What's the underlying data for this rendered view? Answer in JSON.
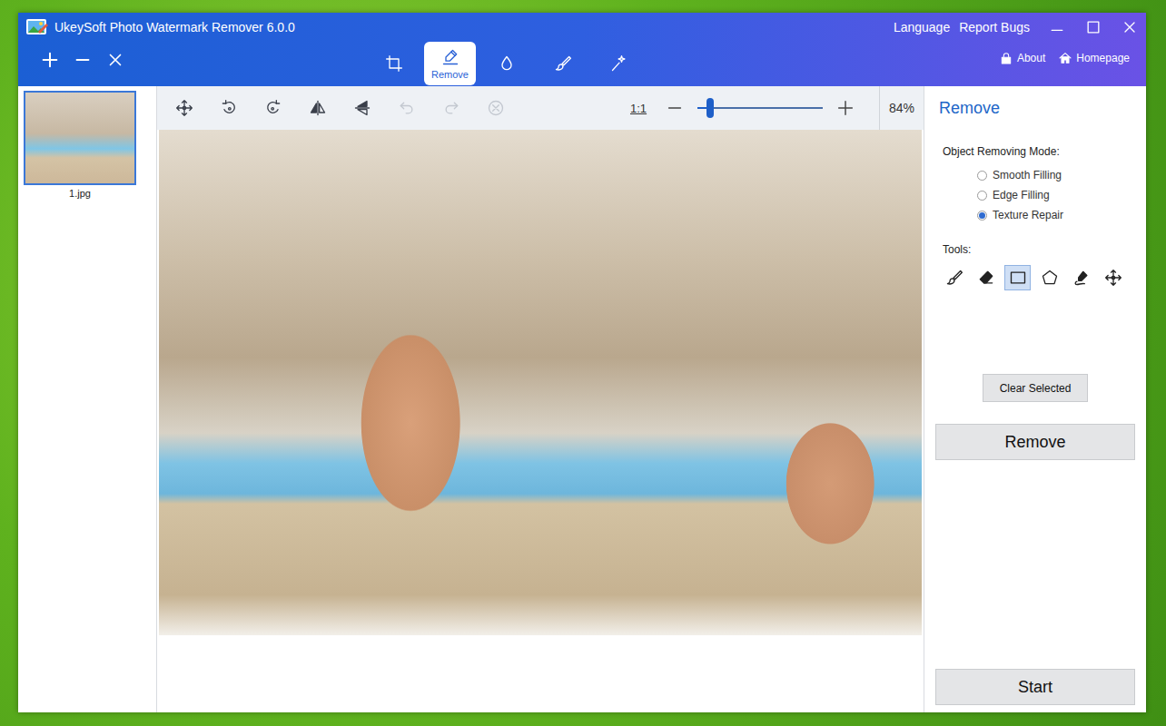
{
  "window": {
    "title": "UkeySoft Photo Watermark Remover 6.0.0"
  },
  "header_links": [
    {
      "label": "Language"
    },
    {
      "label": "Report Bugs"
    }
  ],
  "tabs": [
    {
      "kind": "crop",
      "selected": false
    },
    {
      "kind": "remove",
      "label": "Remove",
      "selected": true
    },
    {
      "kind": "watermark",
      "selected": false
    },
    {
      "kind": "brush",
      "selected": false
    },
    {
      "kind": "magic",
      "selected": false
    }
  ],
  "nav_links": [
    {
      "kind": "about",
      "label": "About"
    },
    {
      "kind": "home",
      "label": "Homepage"
    }
  ],
  "files": [
    {
      "label": "1.jpg",
      "selected": true
    }
  ],
  "canvas_tools": [
    {
      "kind": "move",
      "disabled": false
    },
    {
      "kind": "rotate-left",
      "disabled": false
    },
    {
      "kind": "rotate-right",
      "disabled": false
    },
    {
      "kind": "flip-horizontal",
      "disabled": false
    },
    {
      "kind": "flip-vertical",
      "disabled": false
    },
    {
      "kind": "undo",
      "disabled": true
    },
    {
      "kind": "redo",
      "disabled": true
    },
    {
      "kind": "cancel",
      "disabled": true
    }
  ],
  "zoom": {
    "actual": "1:1",
    "level": 0.1,
    "reading": "84%"
  },
  "panel": {
    "title": "Remove",
    "mode_label": "Object Removing Mode:",
    "modes": [
      {
        "label": "Smooth Filling",
        "selected": false
      },
      {
        "label": "Edge Filling",
        "selected": false
      },
      {
        "label": "Texture Repair",
        "selected": true
      }
    ],
    "tools_label": "Tools:",
    "tools": [
      {
        "kind": "brush",
        "selected": false
      },
      {
        "kind": "eraser",
        "selected": false
      },
      {
        "kind": "rectangle",
        "selected": true
      },
      {
        "kind": "polygon",
        "selected": false
      },
      {
        "kind": "lasso",
        "selected": false
      },
      {
        "kind": "move",
        "selected": false
      }
    ],
    "clear_button": "Clear Selected",
    "remove_button": "Remove",
    "start_button": "Start"
  }
}
